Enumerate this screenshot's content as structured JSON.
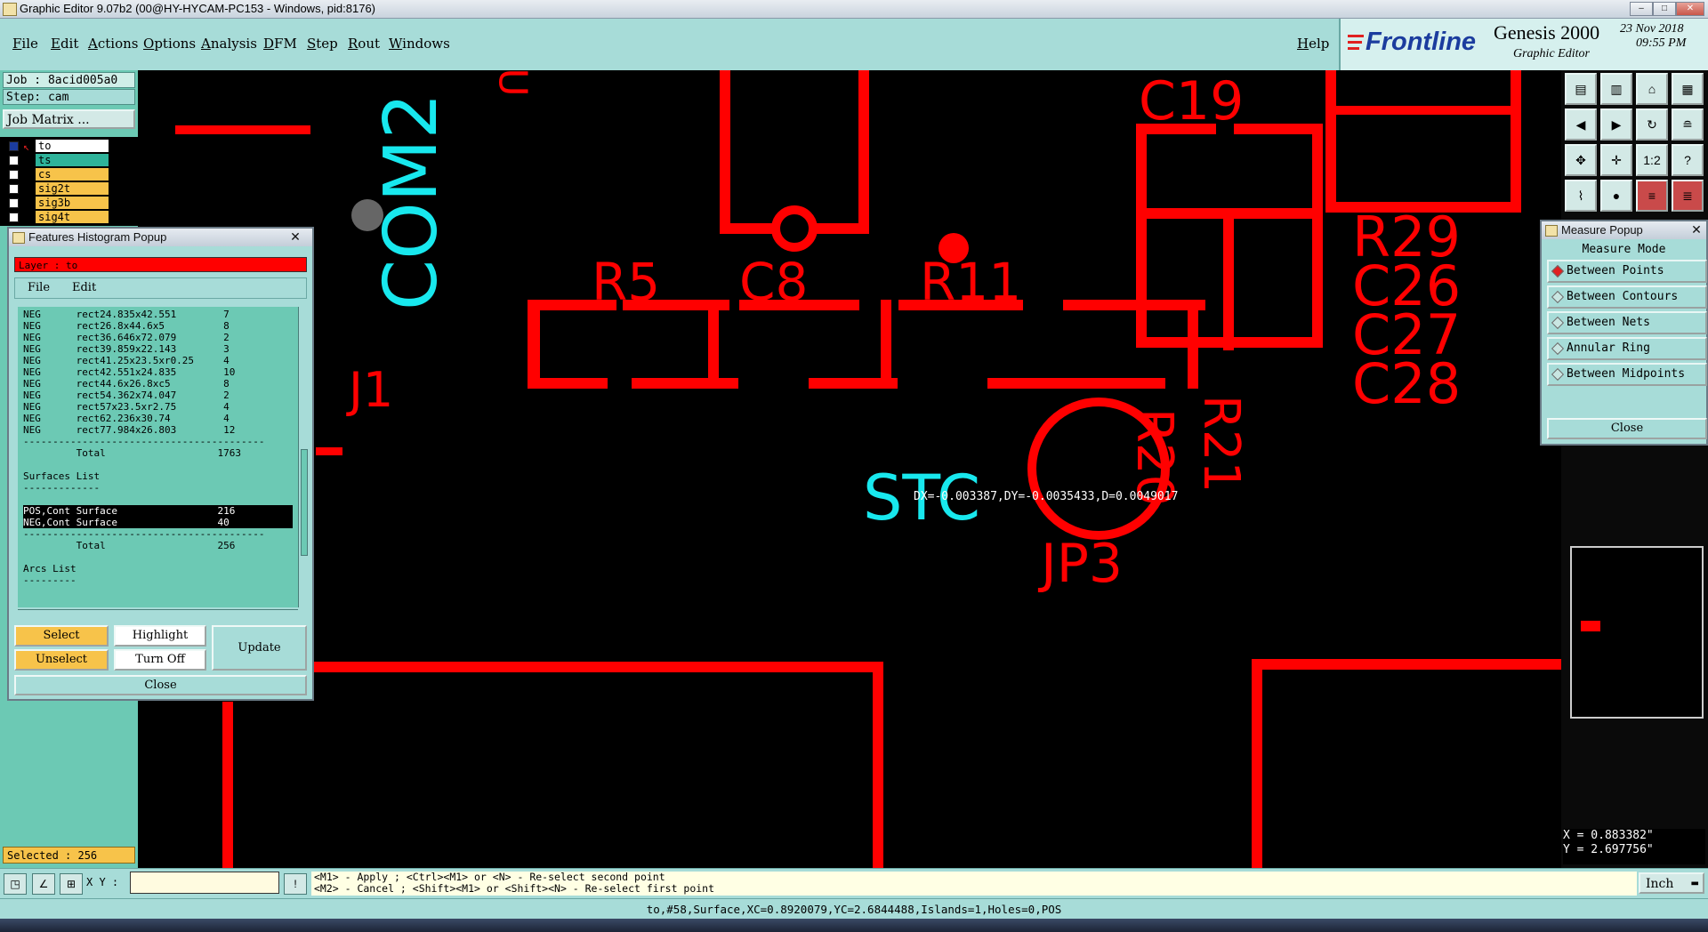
{
  "window": {
    "title": "Graphic Editor 9.07b2 (00@HY-HYCAM-PC153 - Windows, pid:8176)",
    "min": "–",
    "max": "□",
    "close": "✕"
  },
  "menu": [
    "File",
    "Edit",
    "Actions",
    "Options",
    "Analysis",
    "DFM",
    "Step",
    "Rout",
    "Windows"
  ],
  "help": "Help",
  "logo": {
    "brand": "Frontline",
    "product": "Genesis 2000",
    "subtitle": "Graphic Editor",
    "date": "23 Nov 2018",
    "time": "09:55 PM"
  },
  "left": {
    "job": "Job : 8acid005a0",
    "step": "Step: cam",
    "job_matrix": "Job Matrix ...",
    "layers": [
      {
        "name": "to",
        "color": "#ffffff"
      },
      {
        "name": "ts",
        "color": "#2eb39a"
      },
      {
        "name": "cs",
        "color": "#f7c34a"
      },
      {
        "name": "sig2t",
        "color": "#f7c34a"
      },
      {
        "name": "sig3b",
        "color": "#f7c34a"
      },
      {
        "name": "sig4t",
        "color": "#f7c34a"
      }
    ],
    "selected": "Selected : 256"
  },
  "histogram": {
    "title": "Features Histogram Popup",
    "layer": "Layer :  to",
    "menu": [
      "File",
      "Edit"
    ],
    "lines": [
      {
        "text": "NEG      rect24.835x42.551        7"
      },
      {
        "text": "NEG      rect26.8x44.6x5          8"
      },
      {
        "text": "NEG      rect36.646x72.079        2"
      },
      {
        "text": "NEG      rect39.859x22.143        3"
      },
      {
        "text": "NEG      rect41.25x23.5xr0.25     4"
      },
      {
        "text": "NEG      rect42.551x24.835        10"
      },
      {
        "text": "NEG      rect44.6x26.8xc5         8"
      },
      {
        "text": "NEG      rect54.362x74.047        2"
      },
      {
        "text": "NEG      rect57x23.5xr2.75        4"
      },
      {
        "text": "NEG      rect62.236x30.74         4"
      },
      {
        "text": "NEG      rect77.984x26.803        12"
      },
      {
        "text": "-----------------------------------------"
      },
      {
        "text": "         Total                   1763"
      },
      {
        "text": ""
      },
      {
        "text": "Surfaces List"
      },
      {
        "text": "-------------"
      },
      {
        "text": ""
      },
      {
        "text": "POS,Cont Surface                 216"
      },
      {
        "text": "NEG,Cont Surface                 40"
      },
      {
        "text": "-----------------------------------------"
      },
      {
        "text": "         Total                   256"
      },
      {
        "text": ""
      },
      {
        "text": "Arcs List"
      },
      {
        "text": "---------"
      }
    ],
    "buttons": {
      "select": "Select",
      "highlight": "Highlight",
      "unselect": "Unselect",
      "turn_off": "Turn Off",
      "update": "Update",
      "close": "Close"
    }
  },
  "measure": {
    "title": "Measure Popup",
    "mode_label": "Measure Mode",
    "modes": [
      "Between Points",
      "Between Contours",
      "Between Nets",
      "Annular Ring",
      "Between Midpoints"
    ],
    "selected_mode": "Between Points",
    "close": "Close"
  },
  "canvas": {
    "labels": {
      "com2": "COM2",
      "j1": "J1",
      "r5": "R5",
      "c8": "C8",
      "r11": "R11",
      "c19": "C19",
      "r29": "R29",
      "c26": "C26",
      "c27": "C27",
      "c28": "C28",
      "r20": "R20",
      "r21": "R21",
      "stc": "STC",
      "jp3": "JP3",
      "u": "U"
    },
    "measure_readout": "DX=-0.003387,DY=-0.0035433,D=0.0049017"
  },
  "coords": {
    "x": "X = 0.883382\"",
    "y": "Y = 2.697756\""
  },
  "bottom": {
    "xy_label": "X Y :",
    "xy_value": "",
    "hint1": "<M1> - Apply  ; <Ctrl><M1> or <N> - Re-select second point",
    "hint2": "<M2> - Cancel ; <Shift><M1> or <Shift><N> - Re-select first point",
    "units": "Inch",
    "status": "to,#58,Surface,XC=0.8920079,YC=2.6844488,Islands=1,Holes=0,POS"
  }
}
